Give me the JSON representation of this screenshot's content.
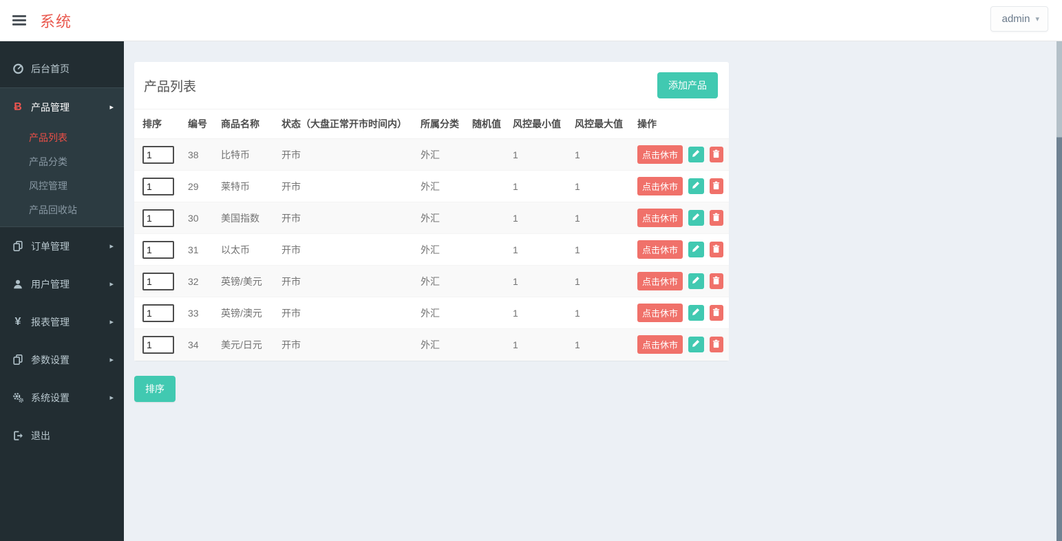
{
  "header": {
    "brand": "系统",
    "user": "admin"
  },
  "icons": {
    "chevron_down": "▾",
    "chevron_right": "▸",
    "bitcoin": "Ƀ",
    "yen": "¥"
  },
  "sidebar": {
    "items": [
      {
        "label": "后台首页"
      },
      {
        "label": "产品管理",
        "children": [
          {
            "label": "产品列表",
            "active": true
          },
          {
            "label": "产品分类"
          },
          {
            "label": "风控管理"
          },
          {
            "label": "产品回收站"
          }
        ]
      },
      {
        "label": "订单管理"
      },
      {
        "label": "用户管理"
      },
      {
        "label": "报表管理"
      },
      {
        "label": "参数设置"
      },
      {
        "label": "系统设置"
      },
      {
        "label": "退出"
      }
    ]
  },
  "main": {
    "card_title": "产品列表",
    "add_button_label": "添加产品",
    "sort_button_label": "排序",
    "table": {
      "headers": [
        "排序",
        "编号",
        "商品名称",
        "状态（大盘正常开市时间内）",
        "所属分类",
        "随机值",
        "风控最小值",
        "风控最大值",
        "操作"
      ],
      "action_close_label": "点击休市",
      "rows": [
        {
          "sort": "1",
          "id": "38",
          "name": "比特币",
          "status": "开市",
          "category": "外汇",
          "random": "",
          "risk_min": "1",
          "risk_max": "1"
        },
        {
          "sort": "1",
          "id": "29",
          "name": "莱特币",
          "status": "开市",
          "category": "外汇",
          "random": "",
          "risk_min": "1",
          "risk_max": "1"
        },
        {
          "sort": "1",
          "id": "30",
          "name": "美国指数",
          "status": "开市",
          "category": "外汇",
          "random": "",
          "risk_min": "1",
          "risk_max": "1"
        },
        {
          "sort": "1",
          "id": "31",
          "name": "以太币",
          "status": "开市",
          "category": "外汇",
          "random": "",
          "risk_min": "1",
          "risk_max": "1"
        },
        {
          "sort": "1",
          "id": "32",
          "name": "英镑/美元",
          "status": "开市",
          "category": "外汇",
          "random": "",
          "risk_min": "1",
          "risk_max": "1"
        },
        {
          "sort": "1",
          "id": "33",
          "name": "英镑/澳元",
          "status": "开市",
          "category": "外汇",
          "random": "",
          "risk_min": "1",
          "risk_max": "1"
        },
        {
          "sort": "1",
          "id": "34",
          "name": "美元/日元",
          "status": "开市",
          "category": "外汇",
          "random": "",
          "risk_min": "1",
          "risk_max": "1"
        }
      ]
    }
  },
  "colors": {
    "teal": "#41c9b1",
    "salmon": "#f0716a",
    "sidebar_bg": "#222d32",
    "sidebar_active_bg": "#2c3b41",
    "accent_red": "#e9544f",
    "content_bg": "#ecf0f5"
  }
}
